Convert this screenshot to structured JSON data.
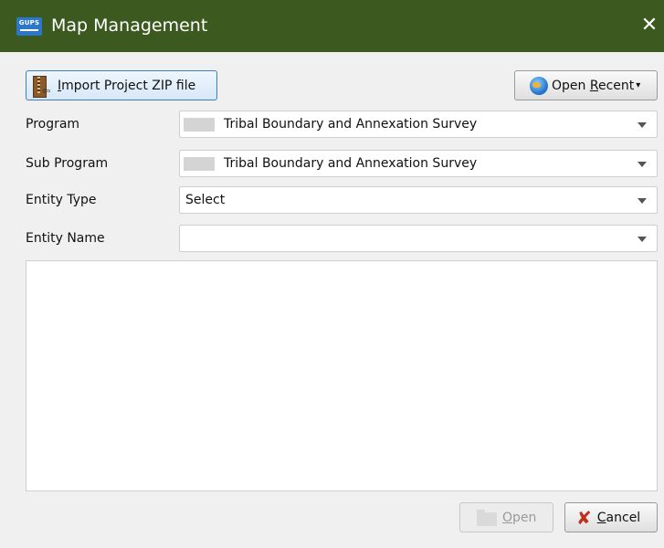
{
  "window": {
    "app_logo_text": "GUPS",
    "title": "Map Management",
    "close_symbol": "✕"
  },
  "toolbar": {
    "import_label": "Import Project ZIP file",
    "import_mnemonic": "I",
    "open_recent_prefix": "Open ",
    "open_recent_mnemonic": "R",
    "open_recent_suffix": "ecent",
    "open_recent_caret": "▾"
  },
  "form": {
    "program": {
      "label": "Program",
      "value": "Tribal Boundary and Annexation Survey"
    },
    "sub_program": {
      "label": "Sub Program",
      "value": "Tribal Boundary and Annexation Survey"
    },
    "entity_type": {
      "label": "Entity Type",
      "value": "Select"
    },
    "entity_name": {
      "label": "Entity Name",
      "value": ""
    }
  },
  "footer": {
    "open_mnemonic": "O",
    "open_rest": "pen",
    "cancel_mnemonic": "C",
    "cancel_rest": "ancel"
  },
  "colors": {
    "titlebar": "#3c5a1f",
    "cancel_icon": "#c0301f",
    "logo": "#2c77c8"
  },
  "icons": {
    "app": "gups-logo-icon",
    "import": "zip-file-icon",
    "recent": "globe-icon",
    "open": "folder-icon",
    "cancel": "x-mark-icon"
  }
}
